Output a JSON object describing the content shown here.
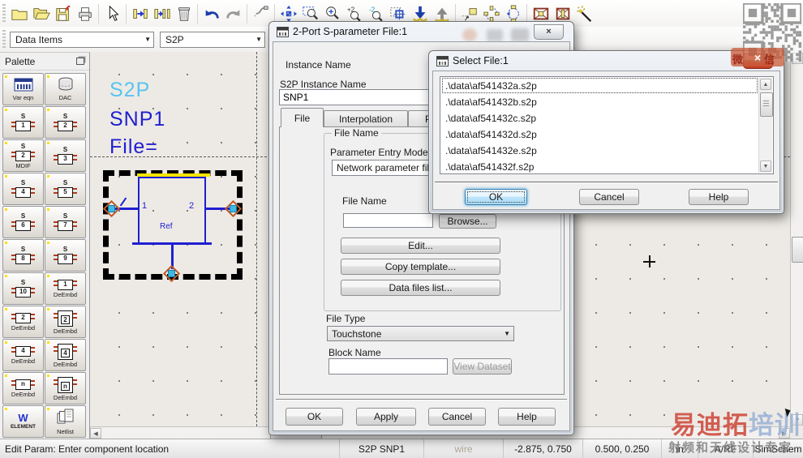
{
  "toolbar": {
    "icons": [
      {
        "name": "new-icon"
      },
      {
        "name": "open-icon"
      },
      {
        "name": "save-icon"
      },
      {
        "name": "print-icon"
      },
      {
        "sep": true
      },
      {
        "name": "pointer-icon"
      },
      {
        "sep": true
      },
      {
        "name": "insert-series-icon"
      },
      {
        "name": "insert-shunt-icon"
      },
      {
        "name": "trash-icon"
      },
      {
        "sep": true
      },
      {
        "name": "undo-icon"
      },
      {
        "name": "redo-icon"
      },
      {
        "sep": true
      },
      {
        "name": "wire-tool-icon"
      },
      {
        "sep": true
      },
      {
        "name": "move-icon"
      },
      {
        "name": "zoom-area-icon"
      },
      {
        "name": "zoom-in-icon"
      },
      {
        "name": "zoom-plus2-icon"
      },
      {
        "name": "zoom-minus2-icon"
      },
      {
        "name": "zoom-center-icon"
      },
      {
        "name": "push-down-icon"
      },
      {
        "name": "pop-up-icon"
      },
      {
        "sep": true
      },
      {
        "name": "name-node-icon"
      },
      {
        "name": "rotate-icon"
      },
      {
        "name": "port-adjust-icon"
      },
      {
        "sep": true
      },
      {
        "name": "deactivate-icon"
      },
      {
        "name": "short-component-icon"
      },
      {
        "name": "wand-icon"
      }
    ]
  },
  "combos": {
    "data_items": "Data Items",
    "component": "S2P"
  },
  "palette": {
    "title": "Palette",
    "buttons": [
      {
        "kind": "vareqn",
        "label": "Var eqn"
      },
      {
        "kind": "dac",
        "label": "DAC"
      },
      {
        "kind": "s",
        "num": "1"
      },
      {
        "kind": "s",
        "num": "2"
      },
      {
        "kind": "smdif",
        "num": "2",
        "label": "MDIF"
      },
      {
        "kind": "s",
        "num": "3"
      },
      {
        "kind": "s",
        "num": "4"
      },
      {
        "kind": "s",
        "num": "5"
      },
      {
        "kind": "s",
        "num": "6"
      },
      {
        "kind": "s",
        "num": "7"
      },
      {
        "kind": "s",
        "num": "8"
      },
      {
        "kind": "s",
        "num": "9"
      },
      {
        "kind": "s",
        "num": "10"
      },
      {
        "kind": "de",
        "num": "1",
        "label": "DeEmbd"
      },
      {
        "kind": "de",
        "num": "2",
        "label": "DeEmbd"
      },
      {
        "kind": "debox",
        "num": "2",
        "label": "DeEmbd"
      },
      {
        "kind": "de",
        "num": "4",
        "label": "DeEmbd"
      },
      {
        "kind": "debox",
        "num": "4",
        "label": "DeEmbd"
      },
      {
        "kind": "de",
        "num": "n",
        "label": "DeEmbd"
      },
      {
        "kind": "debox",
        "num": "n",
        "label": "DeEmbd"
      },
      {
        "kind": "element",
        "label": "ELEMENT"
      },
      {
        "kind": "netlist",
        "label": "Netlist"
      }
    ]
  },
  "canvas": {
    "type_label": "S2P",
    "name_label": "SNP1",
    "file_label": "File=",
    "pin1": "1",
    "pin2": "2",
    "ref": "Ref"
  },
  "dialog_sparam": {
    "title": "2-Port S-parameter File:1",
    "labels": {
      "instance_name": "Instance Name",
      "s2p_instance_name": "S2P Instance Name",
      "file_name_group": "File Name",
      "parameter_entry_mode": "Parameter Entry Mode",
      "file_name": "File Name",
      "file_type": "File Type",
      "block_name": "Block Name"
    },
    "values": {
      "instance_name": "SNP1",
      "parameter_entry_mode": "Network parameter filename",
      "file_name": "",
      "file_type": "Touchstone",
      "block_name": ""
    },
    "tabs": [
      "File",
      "Interpolation",
      "Parameters"
    ],
    "buttons": {
      "browse": "Browse...",
      "edit": "Edit...",
      "copy_template": "Copy template...",
      "data_files_list": "Data files list...",
      "view_dataset": "View Dataset",
      "ok": "OK",
      "apply": "Apply",
      "cancel": "Cancel",
      "help": "Help"
    }
  },
  "dialog_select": {
    "title": "Select File:1",
    "files": [
      ".\\data\\af541432a.s2p",
      ".\\data\\af541432b.s2p",
      ".\\data\\af541432c.s2p",
      ".\\data\\af541432d.s2p",
      ".\\data\\af541432e.s2p",
      ".\\data\\af541432f.s2p"
    ],
    "selected_index": 0,
    "buttons": {
      "ok": "OK",
      "cancel": "Cancel",
      "help": "Help"
    }
  },
  "statusbar": {
    "message": "Edit Param: Enter component location",
    "component": "S2P SNP1",
    "mode": "wire",
    "cursor_coord": "-2.875, 0.750",
    "delta_coord": "0.500, 0.250",
    "units": "in",
    "tech": "A/RF",
    "view": "SimSchem"
  },
  "watermark": {
    "brand_red": "易迪拓",
    "brand_blue": "培训",
    "tagline": "射频和天线设计专家",
    "wechat": "微信"
  },
  "colors": {
    "schematic_blue": "#1f1fd0",
    "s2p_cyan": "#58c4f0",
    "pin_fill": "#3fb9e4",
    "pin_diamond": "#c05a28",
    "ok_focus_border": "#3c7fb1",
    "watermark_red": "#cc4437",
    "watermark_blue": "#9db4d6",
    "status_mode_text": "#b1a89a"
  }
}
